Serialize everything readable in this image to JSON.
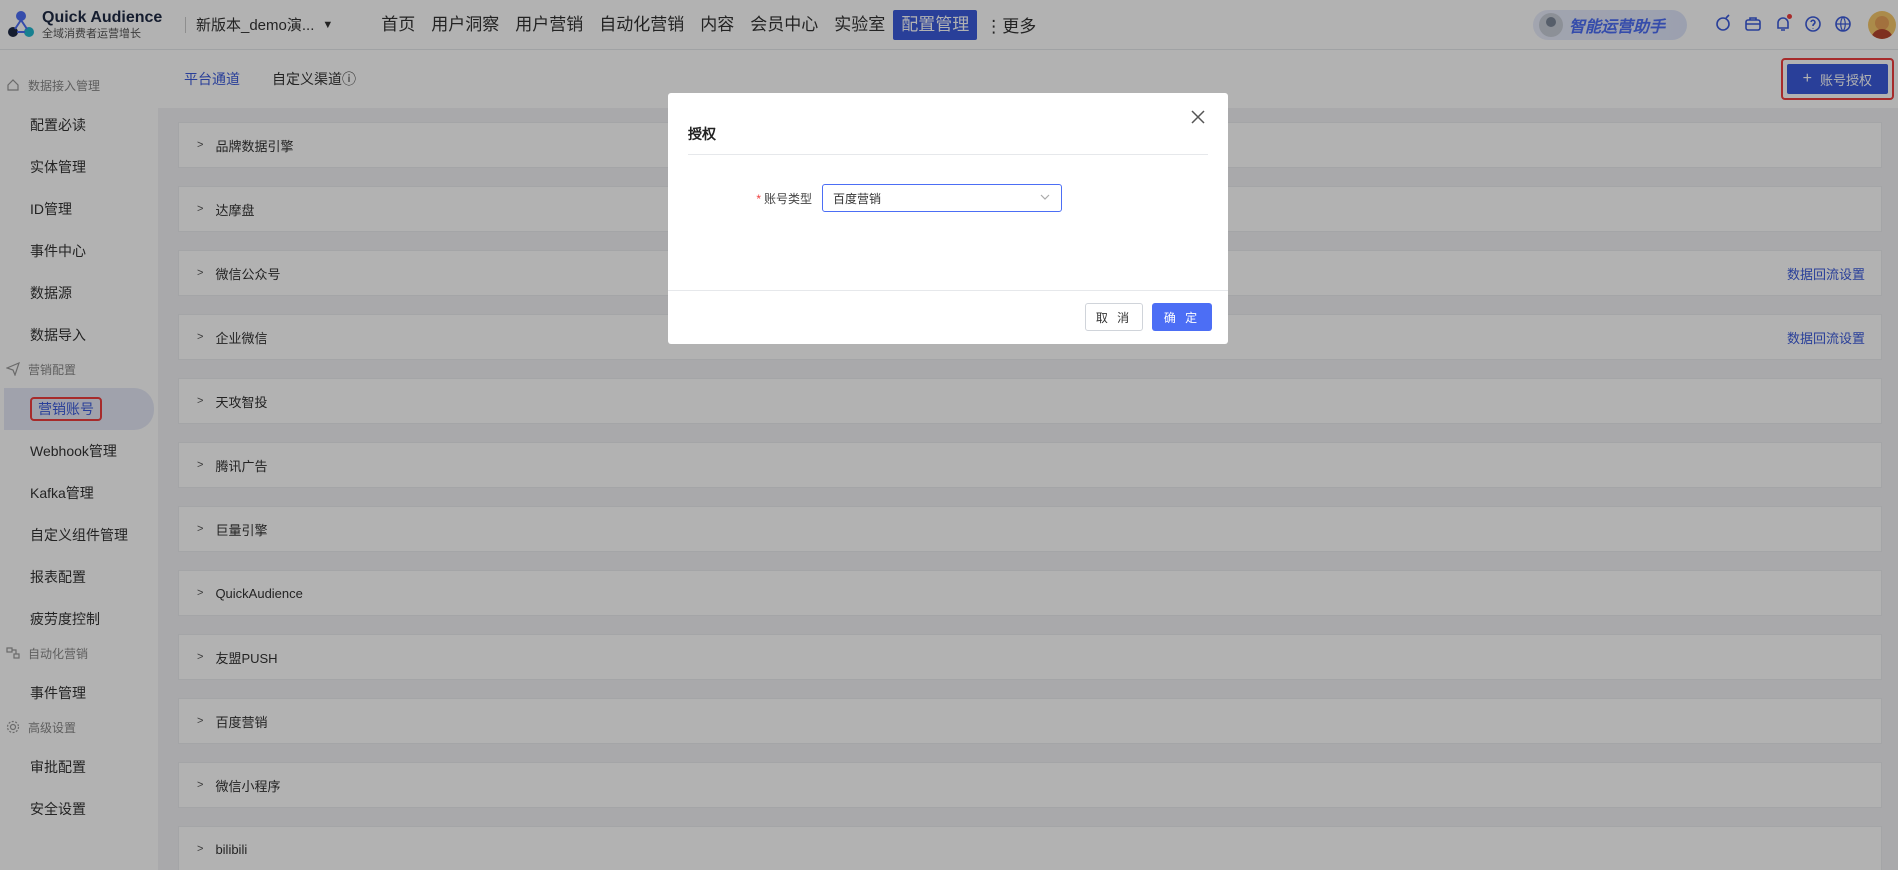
{
  "app": {
    "name": "Quick Audience",
    "tagline": "全域消费者运营增长",
    "tenant": "新版本_demo演..."
  },
  "nav": {
    "items": [
      "首页",
      "用户洞察",
      "用户营销",
      "自动化营销",
      "内容",
      "会员中心",
      "实验室",
      "配置管理"
    ],
    "active_index": 7,
    "more_label": "更多"
  },
  "assistant": {
    "label": "智能运营助手"
  },
  "header_icons": [
    "ai-icon",
    "toolbox-icon",
    "bell-icon",
    "help-icon",
    "globe-icon"
  ],
  "sidebar": {
    "groups": [
      {
        "label": "数据接入管理",
        "icon": "home-icon",
        "items": [
          "配置必读",
          "实体管理",
          "ID管理",
          "事件中心",
          "数据源",
          "数据导入"
        ]
      },
      {
        "label": "营销配置",
        "icon": "send-icon",
        "items": [
          "营销账号",
          "Webhook管理",
          "Kafka管理",
          "自定义组件管理",
          "报表配置",
          "疲劳度控制"
        ]
      },
      {
        "label": "自动化营销",
        "icon": "flow-icon",
        "items": [
          "事件管理"
        ]
      },
      {
        "label": "高级设置",
        "icon": "gear-icon",
        "items": [
          "审批配置",
          "安全设置"
        ]
      }
    ],
    "active_item": "营销账号"
  },
  "main": {
    "tabs": [
      "平台通道",
      "自定义渠道"
    ],
    "active_tab": 0,
    "add_button": "账号授权",
    "channels": [
      {
        "name": "品牌数据引擎",
        "link": ""
      },
      {
        "name": "达摩盘",
        "link": ""
      },
      {
        "name": "微信公众号",
        "link": "数据回流设置"
      },
      {
        "name": "企业微信",
        "link": "数据回流设置"
      },
      {
        "name": "天攻智投",
        "link": ""
      },
      {
        "name": "腾讯广告",
        "link": ""
      },
      {
        "name": "巨量引擎",
        "link": ""
      },
      {
        "name": "QuickAudience",
        "link": ""
      },
      {
        "name": "友盟PUSH",
        "link": ""
      },
      {
        "name": "百度营销",
        "link": ""
      },
      {
        "name": "微信小程序",
        "link": ""
      },
      {
        "name": "bilibili",
        "link": ""
      }
    ]
  },
  "modal": {
    "title": "授权",
    "field_label": "账号类型",
    "field_value": "百度营销",
    "cancel_label": "取 消",
    "ok_label": "确 定"
  },
  "colors": {
    "accent": "#3b5bdb",
    "highlight": "#f03e3e"
  }
}
